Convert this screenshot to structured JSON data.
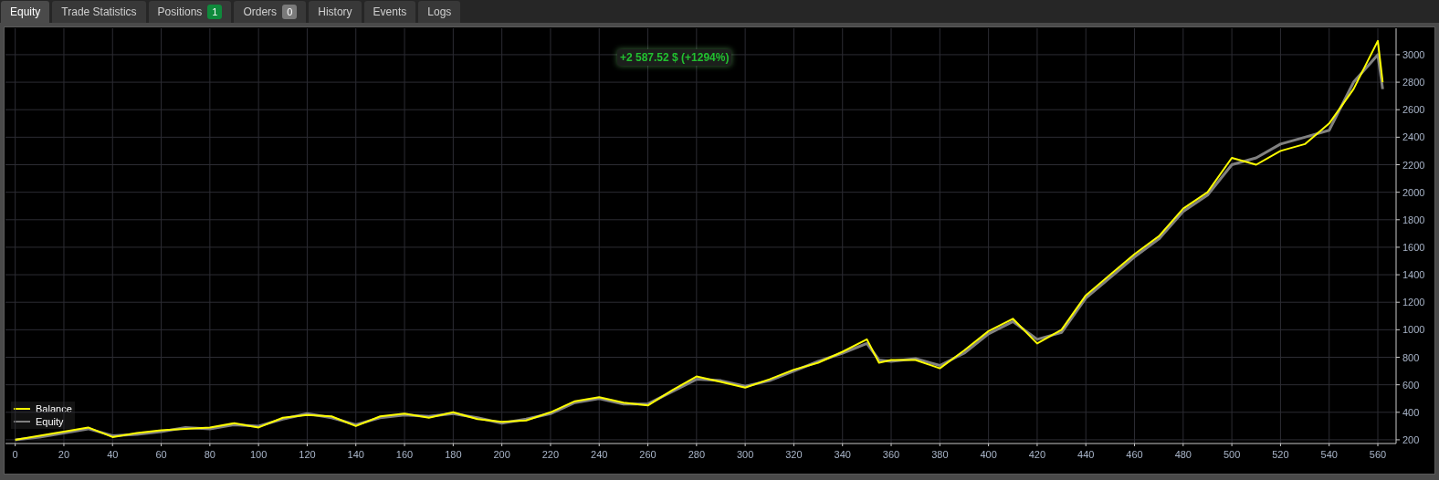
{
  "tabs": [
    {
      "label": "Equity",
      "selected": true
    },
    {
      "label": "Trade Statistics",
      "selected": false
    },
    {
      "label": "Positions",
      "selected": false,
      "badge": {
        "text": "1",
        "color": "#0f8a3c"
      }
    },
    {
      "label": "Orders",
      "selected": false,
      "badge": {
        "text": "0",
        "color": "#7a7a7a"
      }
    },
    {
      "label": "History",
      "selected": false
    },
    {
      "label": "Events",
      "selected": false
    },
    {
      "label": "Logs",
      "selected": false
    }
  ],
  "equity_chart": {
    "profit_label": "+2 587.52 $ (+1294%)",
    "chart_data": {
      "type": "line",
      "grid": true,
      "xlim": [
        -4,
        567.5
      ],
      "ylim": [
        173,
        3192
      ],
      "x": [
        0,
        10,
        20,
        30,
        40,
        50,
        60,
        70,
        80,
        90,
        100,
        110,
        120,
        130,
        140,
        150,
        160,
        170,
        180,
        190,
        200,
        210,
        220,
        230,
        240,
        250,
        260,
        270,
        280,
        290,
        300,
        310,
        320,
        330,
        340,
        350,
        355,
        360,
        370,
        380,
        390,
        400,
        410,
        420,
        430,
        440,
        450,
        460,
        470,
        480,
        490,
        500,
        510,
        520,
        530,
        540,
        550,
        560,
        562
      ],
      "series": [
        {
          "name": "Balance",
          "color": "#ffff00",
          "values": [
            200,
            230,
            260,
            290,
            220,
            250,
            270,
            280,
            290,
            320,
            290,
            360,
            380,
            370,
            300,
            370,
            390,
            360,
            400,
            350,
            330,
            340,
            400,
            480,
            510,
            470,
            450,
            560,
            660,
            620,
            580,
            640,
            710,
            760,
            840,
            930,
            760,
            780,
            780,
            720,
            850,
            990,
            1080,
            900,
            1000,
            1250,
            1400,
            1550,
            1680,
            1880,
            2000,
            2250,
            2200,
            2300,
            2350,
            2500,
            2750,
            3100,
            2800
          ]
        },
        {
          "name": "Equity",
          "color": "#808080",
          "values": [
            200,
            220,
            250,
            280,
            230,
            240,
            260,
            290,
            280,
            310,
            300,
            350,
            390,
            360,
            310,
            360,
            380,
            370,
            390,
            360,
            320,
            350,
            390,
            470,
            500,
            460,
            460,
            550,
            640,
            630,
            590,
            630,
            700,
            770,
            830,
            900,
            780,
            770,
            790,
            740,
            830,
            970,
            1060,
            930,
            980,
            1230,
            1380,
            1530,
            1660,
            1860,
            1980,
            2200,
            2250,
            2350,
            2400,
            2450,
            2800,
            3000,
            2750
          ]
        }
      ],
      "xticks": [
        0,
        20,
        40,
        60,
        80,
        100,
        120,
        140,
        160,
        180,
        200,
        220,
        240,
        260,
        280,
        300,
        320,
        340,
        360,
        380,
        400,
        420,
        440,
        460,
        480,
        500,
        520,
        540,
        560
      ],
      "yticks": [
        200,
        400,
        600,
        800,
        1000,
        1200,
        1400,
        1600,
        1800,
        2000,
        2200,
        2400,
        2600,
        2800,
        3000
      ]
    }
  }
}
